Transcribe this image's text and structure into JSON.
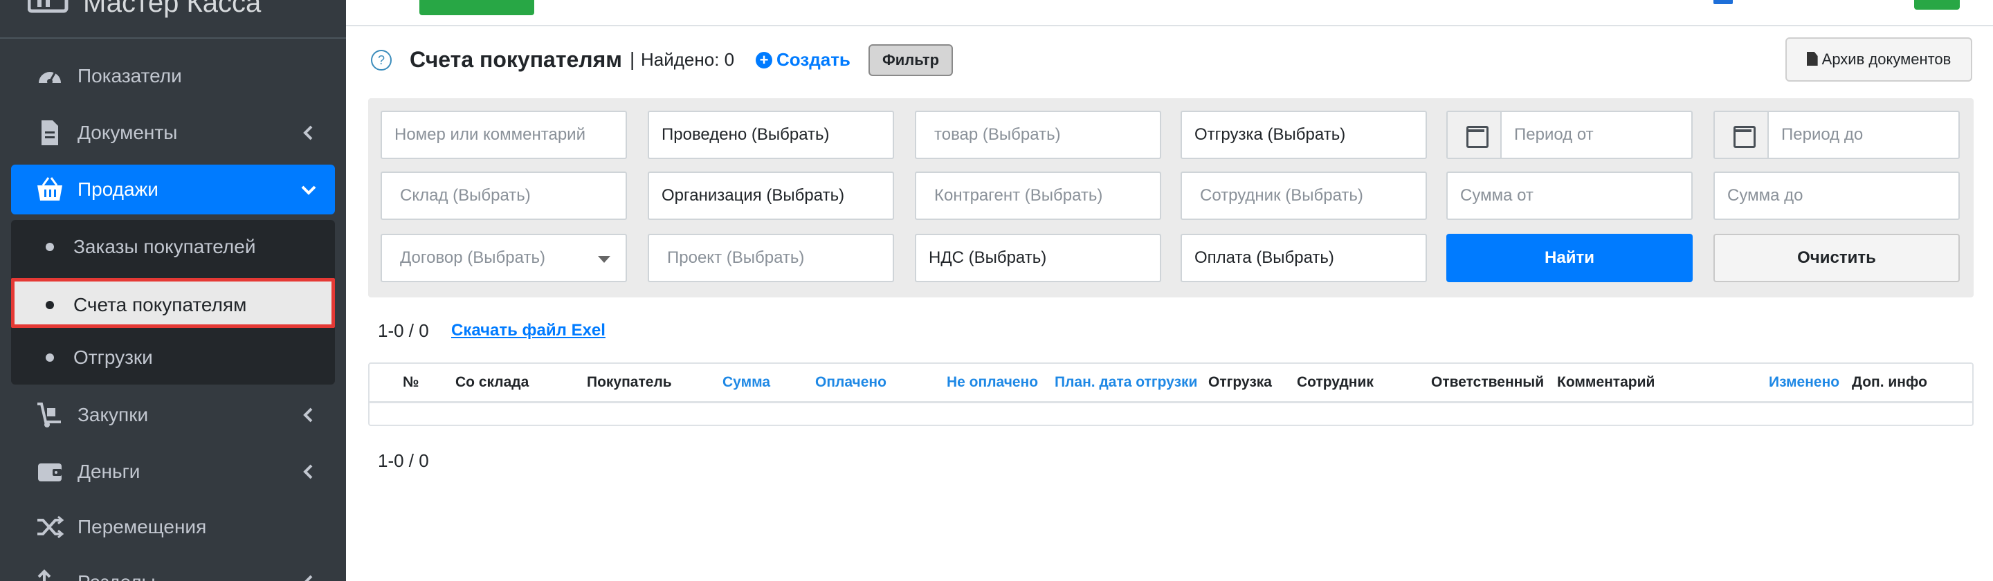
{
  "app": {
    "brand": "Мастер Касса"
  },
  "sidebar": {
    "items": [
      {
        "label": "Показатели"
      },
      {
        "label": "Документы"
      },
      {
        "label": "Продажи"
      },
      {
        "label": "Закупки"
      },
      {
        "label": "Деньги"
      },
      {
        "label": "Перемещения"
      },
      {
        "label": "Разделы"
      }
    ],
    "sales_submenu": [
      {
        "label": "Заказы покупателей"
      },
      {
        "label": "Счета покупателям"
      },
      {
        "label": "Отгрузки"
      }
    ]
  },
  "header": {
    "help": "?",
    "title": "Счета покупателям",
    "separator": "|",
    "found": "Найдено: 0",
    "create": "Создать",
    "filter": "Фильтр",
    "archive": "Архив документов"
  },
  "filters": {
    "number": "Номер или комментарий",
    "posted": "Проведено (Выбрать)",
    "product": "товар (Выбрать)",
    "shipment": "Отгрузка (Выбрать)",
    "period_from": "Период от",
    "period_to": "Период до",
    "warehouse": "Склад (Выбрать)",
    "organization": "Организация (Выбрать)",
    "counterparty": "Контрагент (Выбрать)",
    "employee": "Сотрудник (Выбрать)",
    "sum_from": "Сумма от",
    "sum_to": "Сумма до",
    "contract": "Договор (Выбрать)",
    "project": "Проект (Выбрать)",
    "vat": "НДС (Выбрать)",
    "payment": "Оплата (Выбрать)",
    "find": "Найти",
    "clear": "Очистить"
  },
  "pagination": {
    "top": "1-0 / 0",
    "bottom": "1-0 / 0",
    "excel": "Скачать файл Exel"
  },
  "table": {
    "columns": [
      {
        "label": "№"
      },
      {
        "label": "Со склада"
      },
      {
        "label": "Покупатель"
      },
      {
        "label": "Сумма"
      },
      {
        "label": "Оплачено"
      },
      {
        "label": "Не оплачено"
      },
      {
        "label": "План. дата отгрузки"
      },
      {
        "label": "Отгрузка"
      },
      {
        "label": "Сотрудник"
      },
      {
        "label": "Ответственный"
      },
      {
        "label": "Комментарий"
      },
      {
        "label": "Изменено"
      },
      {
        "label": "Доп. инфо"
      }
    ],
    "rows": []
  },
  "colors": {
    "sidebar_bg": "#343a40",
    "active_item": "#007bff",
    "accent_link": "#007bff",
    "sort_header": "#1e88e5",
    "highlight_border": "#e53935",
    "top_button": "#28a745"
  }
}
